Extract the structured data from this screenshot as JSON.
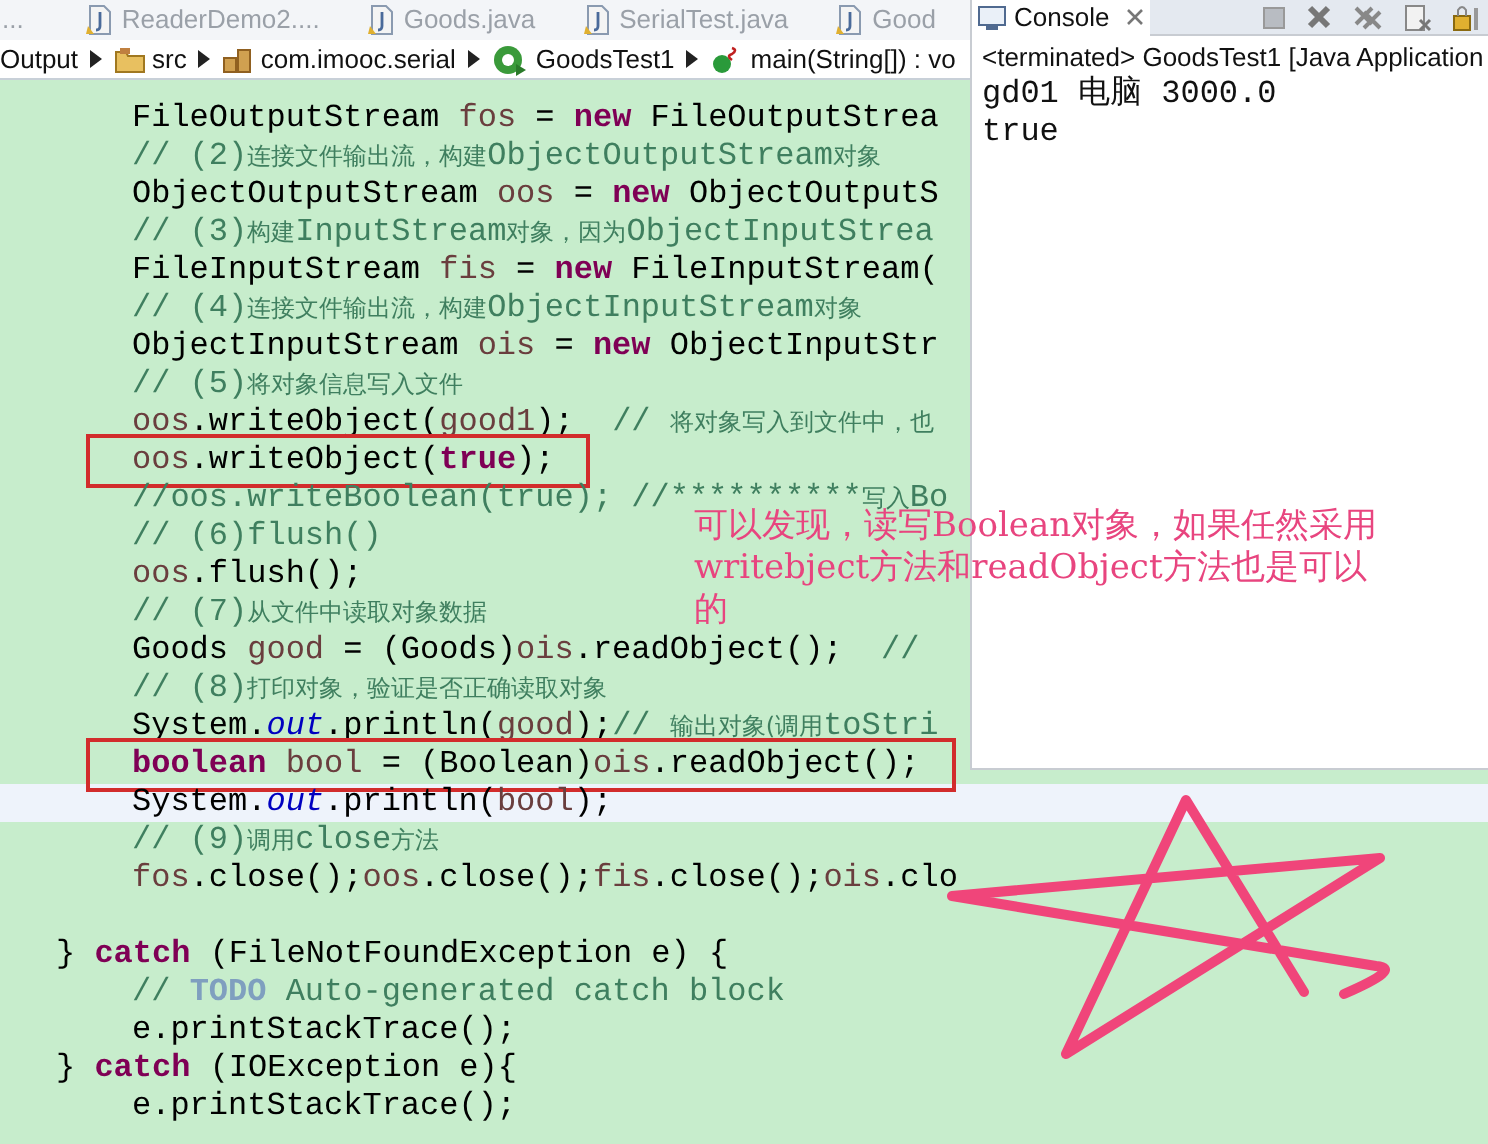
{
  "editor_tabs": {
    "overflow": "...",
    "tabs": [
      {
        "label": "ReaderDemo2...."
      },
      {
        "label": "Goods.java"
      },
      {
        "label": "SerialTest.java"
      },
      {
        "label": "Good"
      }
    ]
  },
  "breadcrumb": [
    {
      "kind": "folder",
      "label": "Output"
    },
    {
      "kind": "src",
      "label": "src"
    },
    {
      "kind": "package",
      "label": "com.imooc.serial"
    },
    {
      "kind": "class",
      "label": "GoodsTest1"
    },
    {
      "kind": "method",
      "label": "main(String[]) : vo"
    }
  ],
  "code_lines": [
    {
      "kind": "inner",
      "tokens": [
        {
          "kind": "plain",
          "text": "FileOutputStream "
        },
        {
          "kind": "variable",
          "text": "fos"
        },
        {
          "kind": "plain",
          "text": " = "
        },
        {
          "kind": "keyword",
          "text": "new"
        },
        {
          "kind": "plain",
          "text": " FileOutputStrea"
        }
      ]
    },
    {
      "kind": "inner",
      "tokens": [
        {
          "kind": "comment",
          "text": "// (2)"
        },
        {
          "kind": "cjk",
          "text": "连接文件输出流，构建"
        },
        {
          "kind": "comment",
          "text": "ObjectOutputStream"
        },
        {
          "kind": "cjk",
          "text": "对象"
        }
      ]
    },
    {
      "kind": "inner",
      "tokens": [
        {
          "kind": "plain",
          "text": "ObjectOutputStream "
        },
        {
          "kind": "variable",
          "text": "oos"
        },
        {
          "kind": "plain",
          "text": " = "
        },
        {
          "kind": "keyword",
          "text": "new"
        },
        {
          "kind": "plain",
          "text": " ObjectOutputS"
        }
      ]
    },
    {
      "kind": "inner",
      "tokens": [
        {
          "kind": "comment",
          "text": "// (3)"
        },
        {
          "kind": "cjk",
          "text": "构建"
        },
        {
          "kind": "comment",
          "text": "InputStream"
        },
        {
          "kind": "cjk",
          "text": "对象，因为"
        },
        {
          "kind": "comment",
          "text": "ObjectInputStrea"
        }
      ]
    },
    {
      "kind": "inner",
      "tokens": [
        {
          "kind": "plain",
          "text": "FileInputStream "
        },
        {
          "kind": "variable",
          "text": "fis"
        },
        {
          "kind": "plain",
          "text": " = "
        },
        {
          "kind": "keyword",
          "text": "new"
        },
        {
          "kind": "plain",
          "text": " FileInputStream("
        }
      ]
    },
    {
      "kind": "inner",
      "tokens": [
        {
          "kind": "comment",
          "text": "// (4)"
        },
        {
          "kind": "cjk",
          "text": "连接文件输出流，构建"
        },
        {
          "kind": "comment",
          "text": "ObjectInputStream"
        },
        {
          "kind": "cjk",
          "text": "对象"
        }
      ]
    },
    {
      "kind": "inner",
      "tokens": [
        {
          "kind": "plain",
          "text": "ObjectInputStream "
        },
        {
          "kind": "variable",
          "text": "ois"
        },
        {
          "kind": "plain",
          "text": " = "
        },
        {
          "kind": "keyword",
          "text": "new"
        },
        {
          "kind": "plain",
          "text": " ObjectInputStr"
        }
      ]
    },
    {
      "kind": "inner",
      "tokens": [
        {
          "kind": "comment",
          "text": "// (5)"
        },
        {
          "kind": "cjk",
          "text": "将对象信息写入文件"
        }
      ]
    },
    {
      "kind": "inner",
      "tokens": [
        {
          "kind": "variable",
          "text": "oos"
        },
        {
          "kind": "plain",
          "text": ".writeObject("
        },
        {
          "kind": "variable",
          "text": "good1"
        },
        {
          "kind": "plain",
          "text": ");  "
        },
        {
          "kind": "comment",
          "text": "// "
        },
        {
          "kind": "cjk",
          "text": "将对象写入到文件中，也"
        }
      ]
    },
    {
      "kind": "inner",
      "boxed": true,
      "tokens": [
        {
          "kind": "variable",
          "text": "oos"
        },
        {
          "kind": "plain",
          "text": ".writeObject("
        },
        {
          "kind": "keyword",
          "text": "true"
        },
        {
          "kind": "plain",
          "text": ");"
        }
      ]
    },
    {
      "kind": "inner",
      "tokens": [
        {
          "kind": "comment",
          "text": "//oos.writeBoolean(true); //**********"
        },
        {
          "kind": "cjk",
          "text": "写入"
        },
        {
          "kind": "comment",
          "text": "Bo"
        }
      ]
    },
    {
      "kind": "inner",
      "tokens": [
        {
          "kind": "comment",
          "text": "// (6)flush()"
        }
      ]
    },
    {
      "kind": "inner",
      "tokens": [
        {
          "kind": "variable",
          "text": "oos"
        },
        {
          "kind": "plain",
          "text": ".flush();"
        }
      ]
    },
    {
      "kind": "inner",
      "tokens": [
        {
          "kind": "comment",
          "text": "// (7)"
        },
        {
          "kind": "cjk",
          "text": "从文件中读取对象数据"
        }
      ]
    },
    {
      "kind": "inner",
      "tokens": [
        {
          "kind": "plain",
          "text": "Goods "
        },
        {
          "kind": "variable",
          "text": "good"
        },
        {
          "kind": "plain",
          "text": " = (Goods)"
        },
        {
          "kind": "variable",
          "text": "ois"
        },
        {
          "kind": "plain",
          "text": ".readObject();  "
        },
        {
          "kind": "comment",
          "text": "//"
        }
      ]
    },
    {
      "kind": "inner",
      "tokens": [
        {
          "kind": "comment",
          "text": "// (8)"
        },
        {
          "kind": "cjk",
          "text": "打印对象，验证是否正确读取对象"
        }
      ]
    },
    {
      "kind": "inner",
      "tokens": [
        {
          "kind": "plain",
          "text": "System."
        },
        {
          "kind": "field",
          "text": "out"
        },
        {
          "kind": "plain",
          "text": ".println("
        },
        {
          "kind": "variable",
          "text": "good"
        },
        {
          "kind": "plain",
          "text": ");"
        },
        {
          "kind": "comment",
          "text": "// "
        },
        {
          "kind": "cjk",
          "text": "输出对象(调用"
        },
        {
          "kind": "comment",
          "text": "toStri"
        }
      ]
    },
    {
      "kind": "inner",
      "boxed": true,
      "tokens": [
        {
          "kind": "keyword",
          "text": "boolean"
        },
        {
          "kind": "variable",
          "text": " bool"
        },
        {
          "kind": "plain",
          "text": " = (Boolean)"
        },
        {
          "kind": "variable",
          "text": "ois"
        },
        {
          "kind": "plain",
          "text": ".readObject();"
        }
      ]
    },
    {
      "kind": "inner",
      "current": true,
      "tokens": [
        {
          "kind": "plain",
          "text": "System."
        },
        {
          "kind": "field",
          "text": "out"
        },
        {
          "kind": "plain",
          "text": ".println("
        },
        {
          "kind": "variable",
          "text": "bool"
        },
        {
          "kind": "plain",
          "text": ");"
        }
      ]
    },
    {
      "kind": "inner",
      "tokens": [
        {
          "kind": "comment",
          "text": "// (9)"
        },
        {
          "kind": "cjk",
          "text": "调用"
        },
        {
          "kind": "comment",
          "text": "close"
        },
        {
          "kind": "cjk",
          "text": "方法"
        }
      ]
    },
    {
      "kind": "inner",
      "tokens": [
        {
          "kind": "variable",
          "text": "fos"
        },
        {
          "kind": "plain",
          "text": ".close();"
        },
        {
          "kind": "variable",
          "text": "oos"
        },
        {
          "kind": "plain",
          "text": ".close();"
        },
        {
          "kind": "variable",
          "text": "fis"
        },
        {
          "kind": "plain",
          "text": ".close();"
        },
        {
          "kind": "variable",
          "text": "ois"
        },
        {
          "kind": "plain",
          "text": ".clo"
        }
      ]
    },
    {
      "kind": "blank"
    },
    {
      "kind": "outer",
      "tokens": [
        {
          "kind": "plain",
          "text": "} "
        },
        {
          "kind": "keyword",
          "text": "catch"
        },
        {
          "kind": "plain",
          "text": " (FileNotFoundException e) {"
        }
      ]
    },
    {
      "kind": "inner",
      "tokens": [
        {
          "kind": "comment",
          "text": "// "
        },
        {
          "kind": "todo",
          "text": "TODO"
        },
        {
          "kind": "comment",
          "text": " Auto-generated catch block"
        }
      ]
    },
    {
      "kind": "inner",
      "tokens": [
        {
          "kind": "plain",
          "text": "e.printStackTrace();"
        }
      ]
    },
    {
      "kind": "outer",
      "tokens": [
        {
          "kind": "plain",
          "text": "} "
        },
        {
          "kind": "keyword",
          "text": "catch"
        },
        {
          "kind": "plain",
          "text": " (IOException e){"
        }
      ]
    },
    {
      "kind": "inner",
      "tokens": [
        {
          "kind": "plain",
          "text": "e.printStackTrace();"
        }
      ]
    }
  ],
  "console": {
    "title": "Console",
    "status": "<terminated> GoodsTest1 [Java Application",
    "output": [
      "gd01 电脑 3000.0",
      "true"
    ]
  },
  "annotation": {
    "lines": [
      "可以发现，读写Boolean对象，如果任然采用",
      "writebject方法和readObject方法也是可以",
      "的"
    ]
  }
}
